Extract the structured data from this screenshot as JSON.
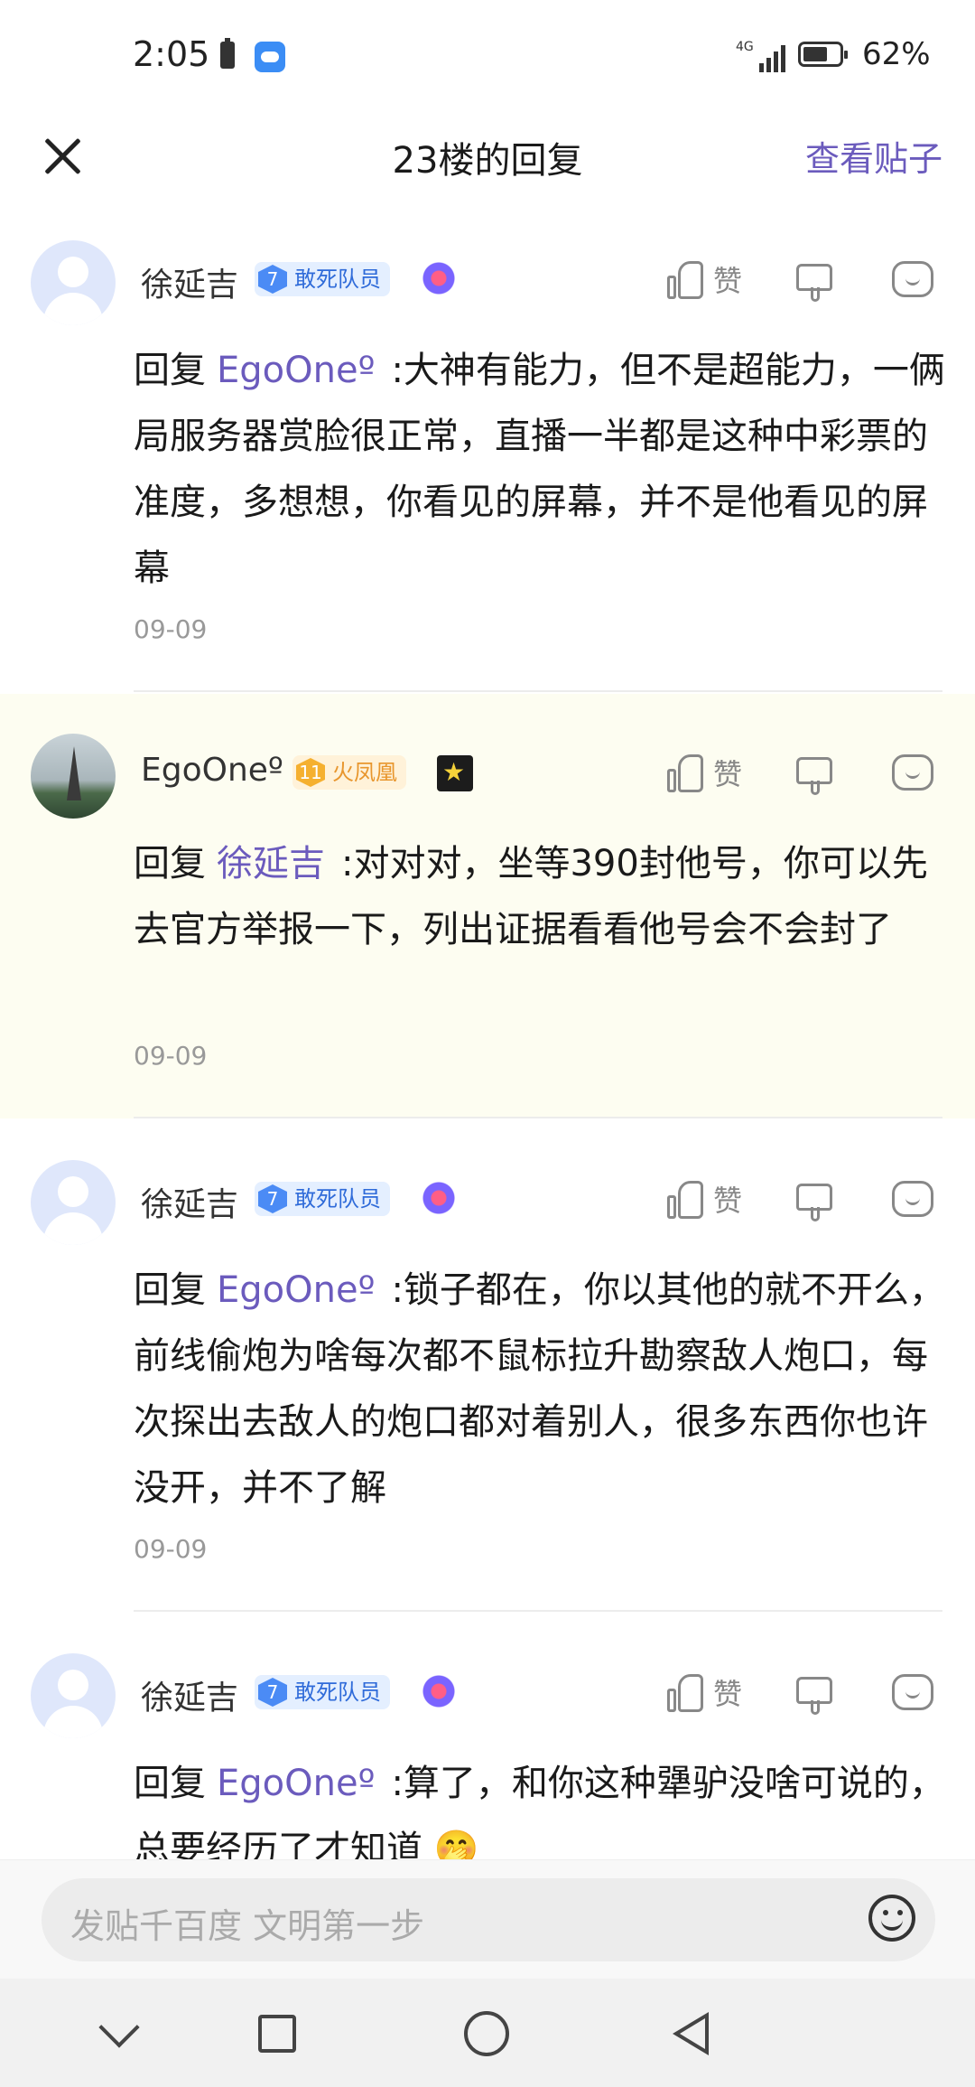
{
  "status_bar": {
    "time": "2:05",
    "network": "4G",
    "battery": "62%",
    "battery_level": 0.62
  },
  "header": {
    "title": "23楼的回复",
    "action": "查看贴子"
  },
  "comments": [
    {
      "user": "徐延吉",
      "level": "7",
      "badge": "敢死队员",
      "like": "赞",
      "prefix": "回复",
      "mention": "EgoOneº",
      "text": ":大神有能力，但不是超能力，一俩局服务器赏脸很正常，直播一半都是这种中彩票的准度，多想想，你看见的屏幕，并不是他看见的屏幕",
      "date": "09-09"
    },
    {
      "user": "EgoOneº",
      "level": "11",
      "badge": "火凤凰",
      "like": "赞",
      "prefix": "回复",
      "mention": "徐延吉",
      "text": ":对对对，坐等390封他号，你可以先去官方举报一下，列出证据看看他号会不会封了",
      "date": "09-09"
    },
    {
      "user": "徐延吉",
      "level": "7",
      "badge": "敢死队员",
      "like": "赞",
      "prefix": "回复",
      "mention": "EgoOneº",
      "text": ":锁子都在，你以其他的就不开么，前线偷炮为啥每次都不鼠标拉升勘察敌人炮口，每次探出去敌人的炮口都对着别人，很多东西你也许没开，并不了解",
      "date": "09-09"
    },
    {
      "user": "徐延吉",
      "level": "7",
      "badge": "敢死队员",
      "like": "赞",
      "prefix": "回复",
      "mention": "EgoOneº",
      "text": ":算了，和你这种犟驴没啥可说的，总要经历了才知道 🤭",
      "date": ""
    }
  ],
  "input": {
    "placeholder": "发贴千百度 文明第一步"
  }
}
